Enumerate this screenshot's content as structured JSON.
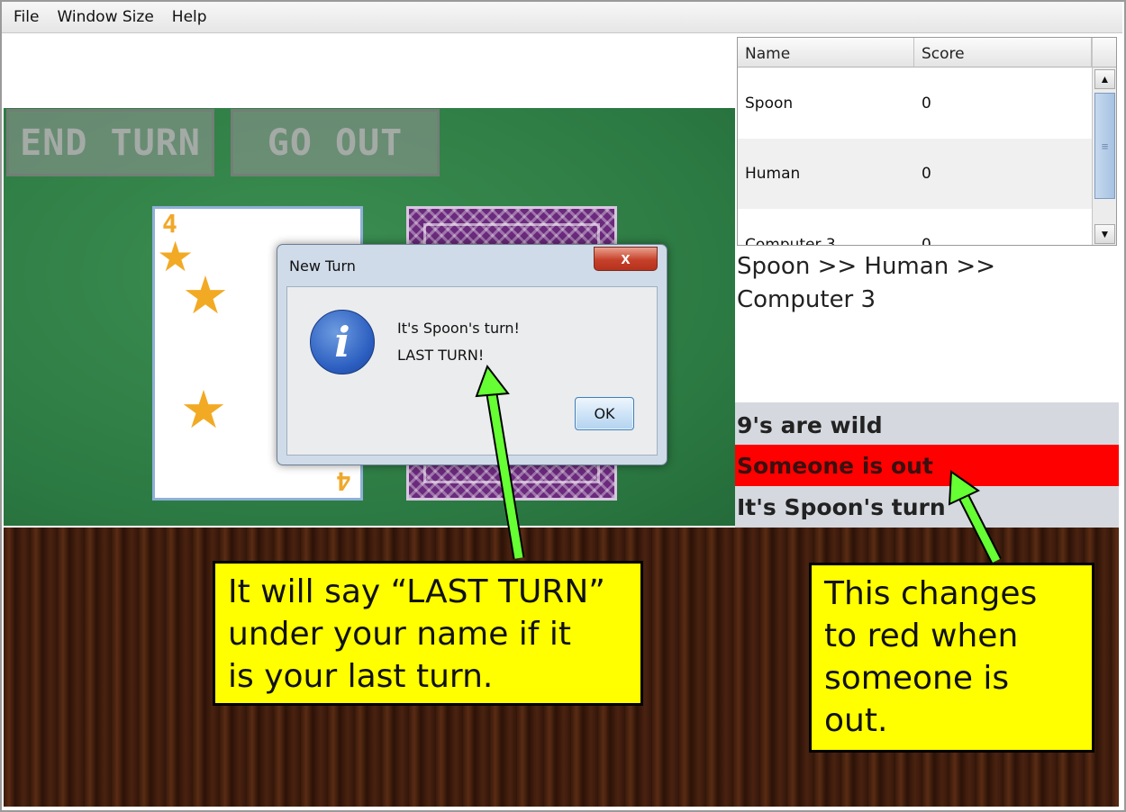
{
  "menu": {
    "items": [
      "File",
      "Window Size",
      "Help"
    ]
  },
  "game": {
    "end_turn_label": "End Turn",
    "go_out_label": "Go Out",
    "card_rank": "4"
  },
  "scoreboard": {
    "columns": [
      "Name",
      "Score"
    ],
    "rows": [
      {
        "name": "Spoon",
        "score": "0"
      },
      {
        "name": "Human",
        "score": "0"
      },
      {
        "name": "Computer 3",
        "score": "0"
      }
    ]
  },
  "turn_order": {
    "line1": "Spoon >> Human >>",
    "line2": "Computer 3"
  },
  "status": {
    "wild": "9's are wild",
    "out": "Someone is out",
    "turn": "It's Spoon's turn",
    "out_color": "#ff0000"
  },
  "dialog": {
    "title": "New Turn",
    "close_symbol": "x",
    "message_line1": "It's Spoon's turn!",
    "message_line2": "LAST TURN!",
    "ok_label": "OK",
    "icon": "info-icon"
  },
  "annotations": {
    "left_callout": [
      "It will say “LAST TURN”",
      "under your name if it",
      "is your last turn."
    ],
    "right_callout": [
      "This changes",
      "to red when",
      "someone is",
      "out."
    ],
    "arrow_color": "#66ff33",
    "callout_color": "#ffff00"
  }
}
